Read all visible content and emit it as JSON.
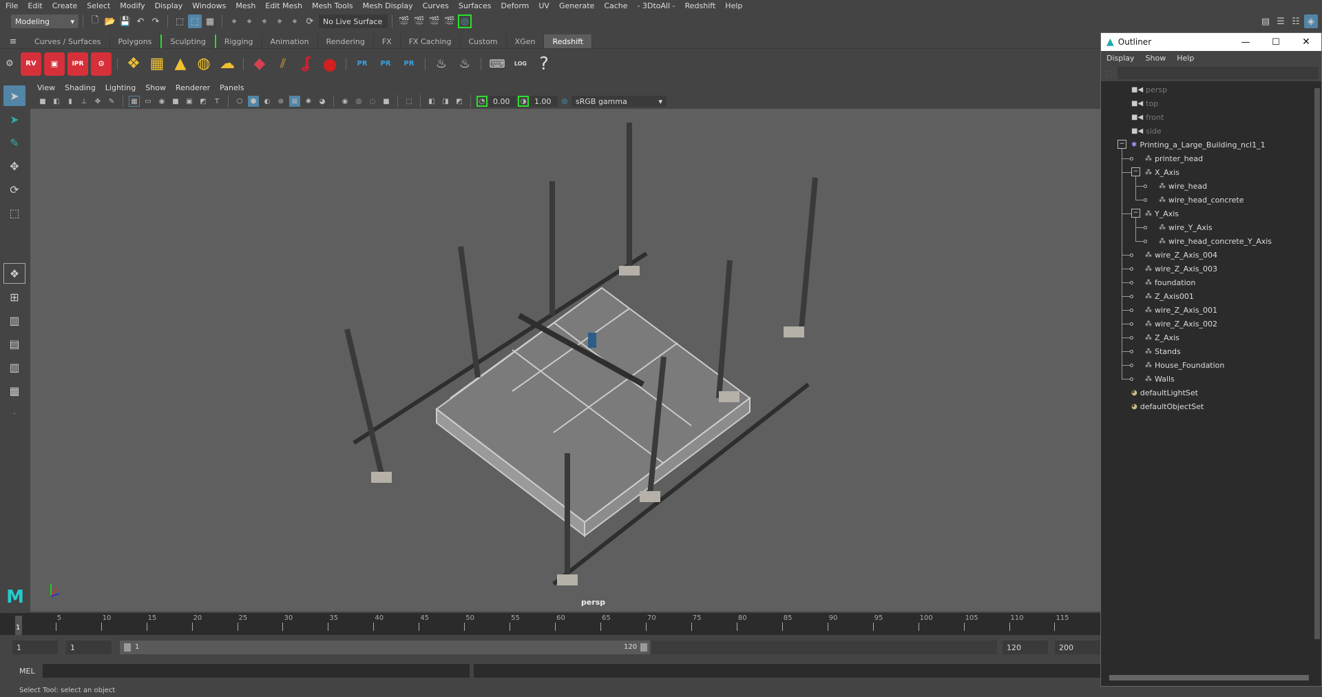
{
  "menubar": [
    "File",
    "Edit",
    "Create",
    "Select",
    "Modify",
    "Display",
    "Windows",
    "Mesh",
    "Edit Mesh",
    "Mesh Tools",
    "Mesh Display",
    "Curves",
    "Surfaces",
    "Deform",
    "UV",
    "Generate",
    "Cache",
    "- 3DtoAll -",
    "Redshift",
    "Help"
  ],
  "statusline": {
    "mode": "Modeling",
    "live_surface": "No Live Surface"
  },
  "shelf_tabs": [
    {
      "label": "Curves / Surfaces"
    },
    {
      "label": "Polygons"
    },
    {
      "label": "Sculpting"
    },
    {
      "label": "Rigging"
    },
    {
      "label": "Animation"
    },
    {
      "label": "Rendering"
    },
    {
      "label": "FX"
    },
    {
      "label": "FX Caching"
    },
    {
      "label": "Custom"
    },
    {
      "label": "XGen"
    },
    {
      "label": "Redshift",
      "active": true
    }
  ],
  "shelf_icons": {
    "rv": "RV",
    "ipr": "IPR",
    "pr": "PR",
    "log": "LOG",
    "help": "?"
  },
  "panel_menu": [
    "View",
    "Shading",
    "Lighting",
    "Show",
    "Renderer",
    "Panels"
  ],
  "panel_toolbar": {
    "exposure": "0.00",
    "gamma": "1.00",
    "color_space": "sRGB gamma"
  },
  "viewport": {
    "camera_label": "persp"
  },
  "timeline": {
    "ticks": [
      5,
      10,
      15,
      20,
      25,
      30,
      35,
      40,
      45,
      50,
      55,
      60,
      65,
      70,
      75,
      80,
      85,
      90,
      95,
      100,
      105,
      110,
      115
    ],
    "current_frame": "1"
  },
  "range": {
    "start": "1",
    "playback_start": "1",
    "range_start": "1",
    "range_end": "120",
    "playback_end": "120",
    "end": "200"
  },
  "cmdline": {
    "label": "MEL"
  },
  "helpline": "Select Tool: select an object",
  "outliner": {
    "title": "Outliner",
    "menu": [
      "Display",
      "Show",
      "Help"
    ],
    "cameras": [
      "persp",
      "top",
      "front",
      "side"
    ],
    "root": "Printing_a_Large_Building_ncl1_1",
    "children": [
      {
        "label": "printer_head"
      },
      {
        "label": "X_Axis",
        "children": [
          "wire_head",
          "wire_head_concrete"
        ]
      },
      {
        "label": "Y_Axis",
        "children": [
          "wire_Y_Axis",
          "wire_head_concrete_Y_Axis"
        ]
      },
      {
        "label": "wire_Z_Axis_004"
      },
      {
        "label": "wire_Z_Axis_003"
      },
      {
        "label": "foundation"
      },
      {
        "label": "Z_Axis001"
      },
      {
        "label": "wire_Z_Axis_001"
      },
      {
        "label": "wire_Z_Axis_002"
      },
      {
        "label": "Z_Axis"
      },
      {
        "label": "Stands"
      },
      {
        "label": "House_Foundation"
      },
      {
        "label": "Walls"
      }
    ],
    "sets": [
      "defaultLightSet",
      "defaultObjectSet"
    ]
  }
}
